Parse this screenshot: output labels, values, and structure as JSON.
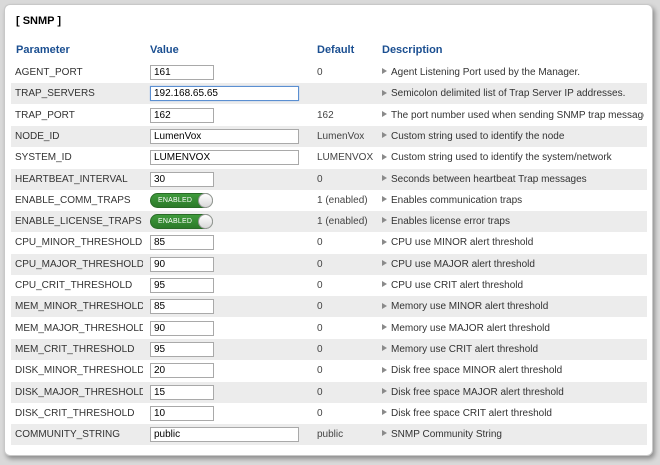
{
  "section_title": "[ SNMP ]",
  "headers": {
    "parameter": "Parameter",
    "value": "Value",
    "default": "Default",
    "description": "Description"
  },
  "rows": [
    {
      "param": "AGENT_PORT",
      "value": "161",
      "input": "short",
      "default": "0",
      "desc": "Agent Listening Port used by the Manager."
    },
    {
      "param": "TRAP_SERVERS",
      "value": "192.168.65.65",
      "input": "long",
      "focus": true,
      "default": "",
      "desc": "Semicolon delimited list of Trap Server IP addresses."
    },
    {
      "param": "TRAP_PORT",
      "value": "162",
      "input": "short",
      "default": "162",
      "desc": "The port number used when sending SNMP trap messages"
    },
    {
      "param": "NODE_ID",
      "value": "LumenVox",
      "input": "long",
      "default": "LumenVox",
      "desc": "Custom string used to identify the node"
    },
    {
      "param": "SYSTEM_ID",
      "value": "LUMENVOX",
      "input": "long",
      "default": "LUMENVOX",
      "desc": "Custom string used to identify the system/network"
    },
    {
      "param": "HEARTBEAT_INTERVAL",
      "value": "30",
      "input": "short",
      "default": "0",
      "desc": "Seconds between heartbeat Trap messages"
    },
    {
      "param": "ENABLE_COMM_TRAPS",
      "value": "ENABLED",
      "input": "toggle",
      "default": "1 (enabled)",
      "desc": "Enables communication traps"
    },
    {
      "param": "ENABLE_LICENSE_TRAPS",
      "value": "ENABLED",
      "input": "toggle",
      "default": "1 (enabled)",
      "desc": "Enables license error traps"
    },
    {
      "param": "CPU_MINOR_THRESHOLD",
      "value": "85",
      "input": "short",
      "default": "0",
      "desc": "CPU use MINOR alert threshold"
    },
    {
      "param": "CPU_MAJOR_THRESHOLD",
      "value": "90",
      "input": "short",
      "default": "0",
      "desc": "CPU use MAJOR alert threshold"
    },
    {
      "param": "CPU_CRIT_THRESHOLD",
      "value": "95",
      "input": "short",
      "default": "0",
      "desc": "CPU use CRIT alert threshold"
    },
    {
      "param": "MEM_MINOR_THRESHOLD",
      "value": "85",
      "input": "short",
      "default": "0",
      "desc": "Memory use MINOR alert threshold"
    },
    {
      "param": "MEM_MAJOR_THRESHOLD",
      "value": "90",
      "input": "short",
      "default": "0",
      "desc": "Memory use MAJOR alert threshold"
    },
    {
      "param": "MEM_CRIT_THRESHOLD",
      "value": "95",
      "input": "short",
      "default": "0",
      "desc": "Memory use CRIT alert threshold"
    },
    {
      "param": "DISK_MINOR_THRESHOLD",
      "value": "20",
      "input": "short",
      "default": "0",
      "desc": "Disk free space MINOR alert threshold"
    },
    {
      "param": "DISK_MAJOR_THRESHOLD",
      "value": "15",
      "input": "short",
      "default": "0",
      "desc": "Disk free space MAJOR alert threshold"
    },
    {
      "param": "DISK_CRIT_THRESHOLD",
      "value": "10",
      "input": "short",
      "default": "0",
      "desc": "Disk free space CRIT alert threshold"
    },
    {
      "param": "COMMUNITY_STRING",
      "value": "public",
      "input": "long",
      "default": "public",
      "desc": "SNMP Community String"
    }
  ]
}
